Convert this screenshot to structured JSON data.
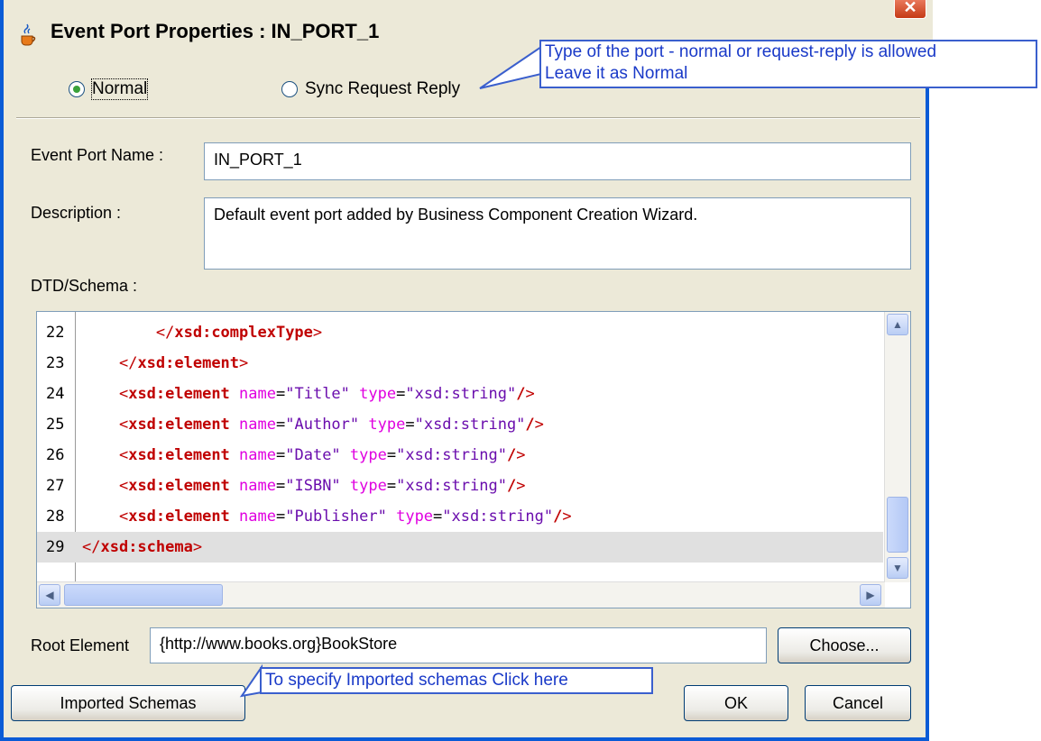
{
  "window": {
    "title": "Event Port Properties : IN_PORT_1",
    "close_glyph": "✕"
  },
  "port_type": {
    "options": [
      {
        "label": "Normal",
        "selected": true
      },
      {
        "label": "Sync Request Reply",
        "selected": false
      }
    ]
  },
  "form": {
    "event_port_name_label": "Event Port Name :",
    "event_port_name_value": "IN_PORT_1",
    "description_label": "Description :",
    "description_value": "Default event port added by Business Component Creation Wizard.",
    "schema_label": "DTD/Schema :"
  },
  "schema_editor": {
    "lines": [
      {
        "num": "22",
        "indent": "        ",
        "kind": "close",
        "tag": "xsd:complexType"
      },
      {
        "num": "23",
        "indent": "    ",
        "kind": "close",
        "tag": "xsd:element"
      },
      {
        "num": "24",
        "indent": "    ",
        "kind": "element",
        "tag": "xsd:element",
        "name": "Title",
        "type": "xsd:string"
      },
      {
        "num": "25",
        "indent": "    ",
        "kind": "element",
        "tag": "xsd:element",
        "name": "Author",
        "type": "xsd:string"
      },
      {
        "num": "26",
        "indent": "    ",
        "kind": "element",
        "tag": "xsd:element",
        "name": "Date",
        "type": "xsd:string"
      },
      {
        "num": "27",
        "indent": "    ",
        "kind": "element",
        "tag": "xsd:element",
        "name": "ISBN",
        "type": "xsd:string"
      },
      {
        "num": "28",
        "indent": "    ",
        "kind": "element",
        "tag": "xsd:element",
        "name": "Publisher",
        "type": "xsd:string"
      },
      {
        "num": "29",
        "indent": "",
        "kind": "close",
        "tag": "xsd:schema",
        "current": true
      }
    ]
  },
  "root_element": {
    "label": "Root Element",
    "value": "{http://www.books.org}BookStore",
    "choose_label": "Choose..."
  },
  "buttons": {
    "imported_schemas": "Imported Schemas",
    "ok": "OK",
    "cancel": "Cancel"
  },
  "callouts": {
    "port_type_line1": "Type of the port - normal or request-reply is allowed",
    "port_type_line2": "Leave it as Normal",
    "imported": "To specify Imported schemas Click here"
  },
  "colors": {
    "window_border": "#0A5BD6",
    "dialog_bg": "#ECE9D8",
    "tag": "#C00000",
    "attribute": "#E000E0",
    "attr_value": "#6A0DAD",
    "callout_text": "#1A3AC8"
  }
}
